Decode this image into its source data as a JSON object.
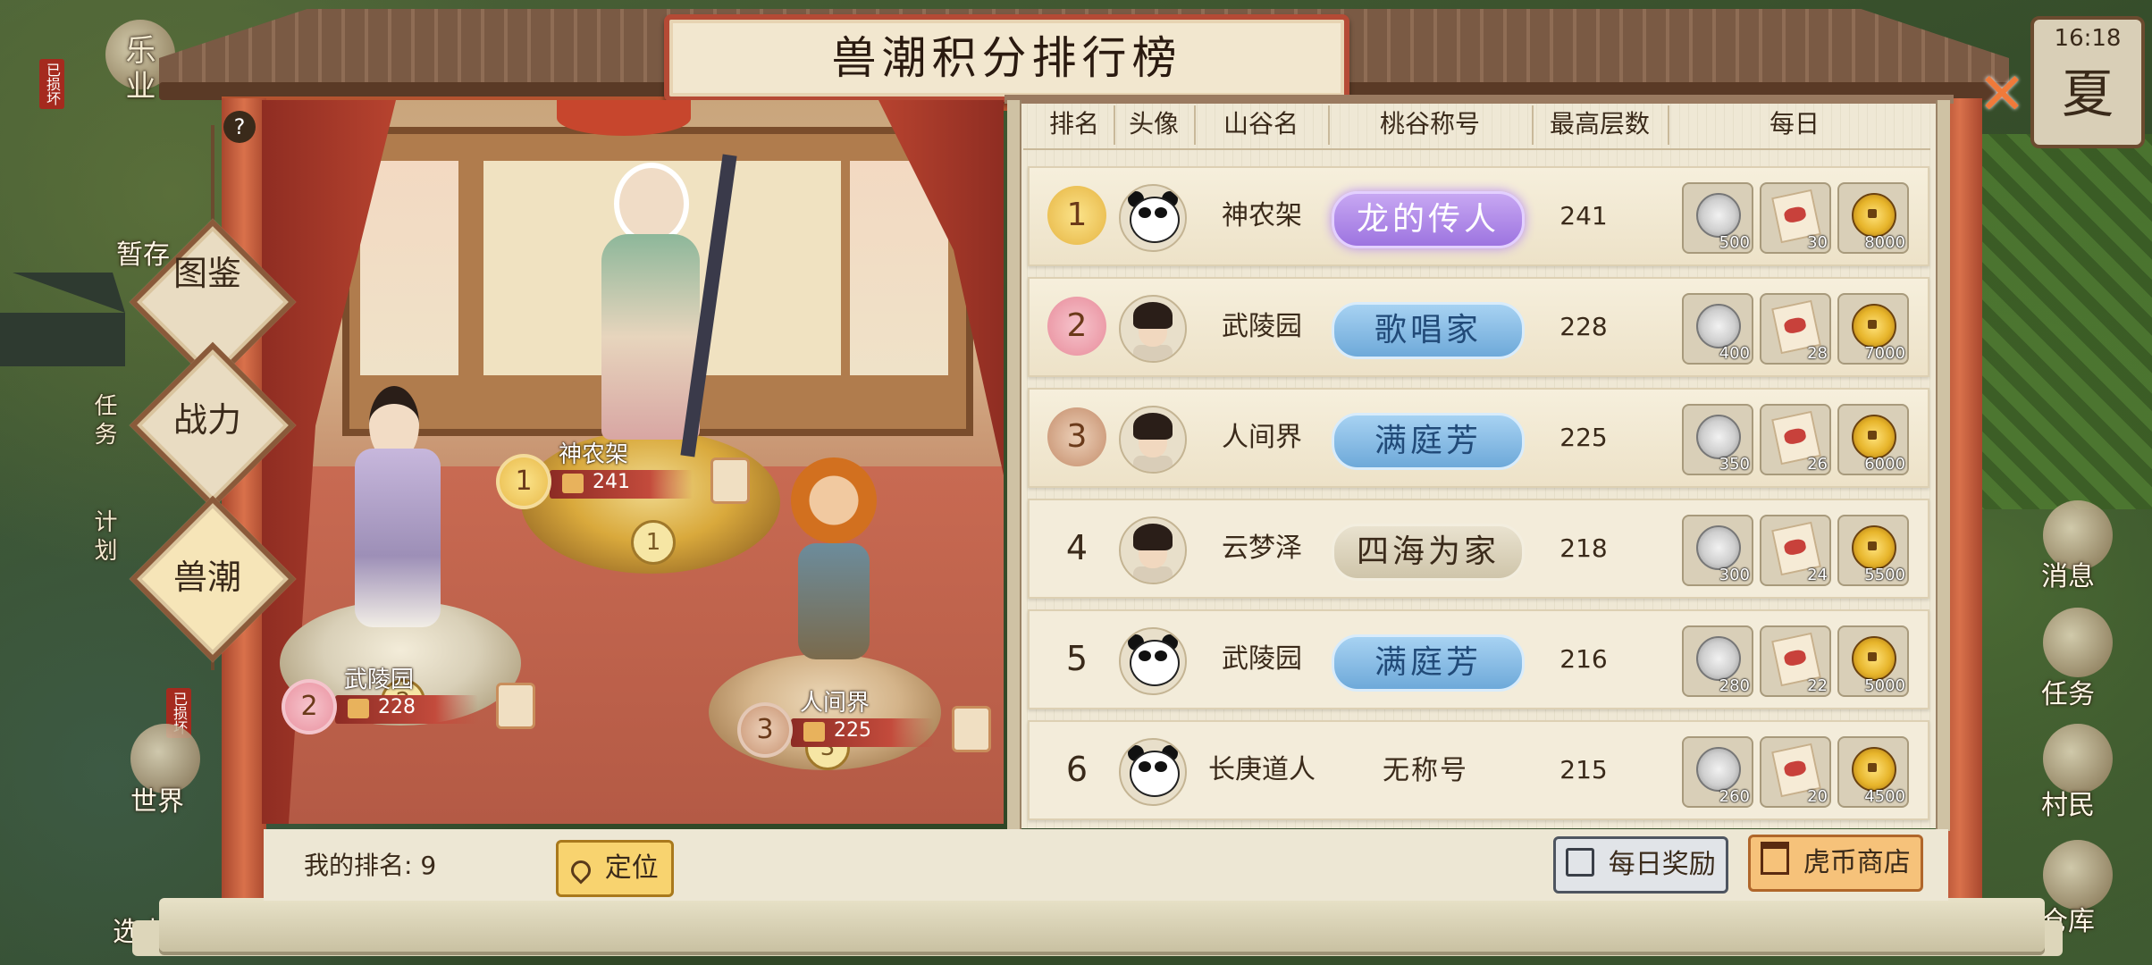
{
  "title": "兽潮积分排行榜",
  "clock": {
    "time": "16:18",
    "season": "夏"
  },
  "side_left": {
    "top_label": "乐业",
    "damaged_1": "已损坏",
    "item_2": "暂存",
    "task": "任务",
    "plan": "计划",
    "damaged_2": "已损坏",
    "world": "世界",
    "select": "选中"
  },
  "side_right": {
    "message": "消息",
    "task": "任务",
    "villager": "村民",
    "warehouse": "仓库"
  },
  "tabs": [
    {
      "label": "图鉴",
      "active": false
    },
    {
      "label": "战力",
      "active": false
    },
    {
      "label": "兽潮",
      "active": true
    }
  ],
  "help": "?",
  "close": "✕",
  "podium": [
    {
      "rank": "1",
      "name": "神农架",
      "score": "241"
    },
    {
      "rank": "2",
      "name": "武陵园",
      "score": "228"
    },
    {
      "rank": "3",
      "name": "人间界",
      "score": "225"
    }
  ],
  "table": {
    "headers": [
      "排名",
      "头像",
      "山谷名",
      "桃谷称号",
      "最高层数",
      "每日"
    ],
    "rows": [
      {
        "rank": "1",
        "avatar": "panda",
        "valley": "神农架",
        "title": "龙的传人",
        "title_style": "purple",
        "floors": "241",
        "rewards": [
          "500",
          "30",
          "8000"
        ]
      },
      {
        "rank": "2",
        "avatar": "girl",
        "valley": "武陵园",
        "title": "歌唱家",
        "title_style": "blue",
        "floors": "228",
        "rewards": [
          "400",
          "28",
          "7000"
        ]
      },
      {
        "rank": "3",
        "avatar": "woman",
        "valley": "人间界",
        "title": "满庭芳",
        "title_style": "blue",
        "floors": "225",
        "rewards": [
          "350",
          "26",
          "6000"
        ]
      },
      {
        "rank": "4",
        "avatar": "boy",
        "valley": "云梦泽",
        "title": "四海为家",
        "title_style": "grey",
        "floors": "218",
        "rewards": [
          "300",
          "24",
          "5500"
        ]
      },
      {
        "rank": "5",
        "avatar": "panda",
        "valley": "武陵园",
        "title": "满庭芳",
        "title_style": "blue",
        "floors": "216",
        "rewards": [
          "280",
          "22",
          "5000"
        ]
      },
      {
        "rank": "6",
        "avatar": "panda",
        "valley": "长庚道人",
        "title": "无称号",
        "title_style": "none",
        "floors": "215",
        "rewards": [
          "260",
          "20",
          "4500"
        ]
      }
    ]
  },
  "bottom": {
    "my_rank_label": "我的排名:",
    "my_rank_value": "9",
    "locate_btn": "定位",
    "daily_btn": "每日奖励",
    "shop_btn": "虎币商店"
  },
  "colors": {
    "frame_red": "#b54a35",
    "medal_gold": "#f2c84b",
    "medal_silver": "#f0a5b0",
    "medal_bronze": "#c98a6a",
    "title_purple": "#9d74e0",
    "title_blue": "#6ea9d9"
  }
}
